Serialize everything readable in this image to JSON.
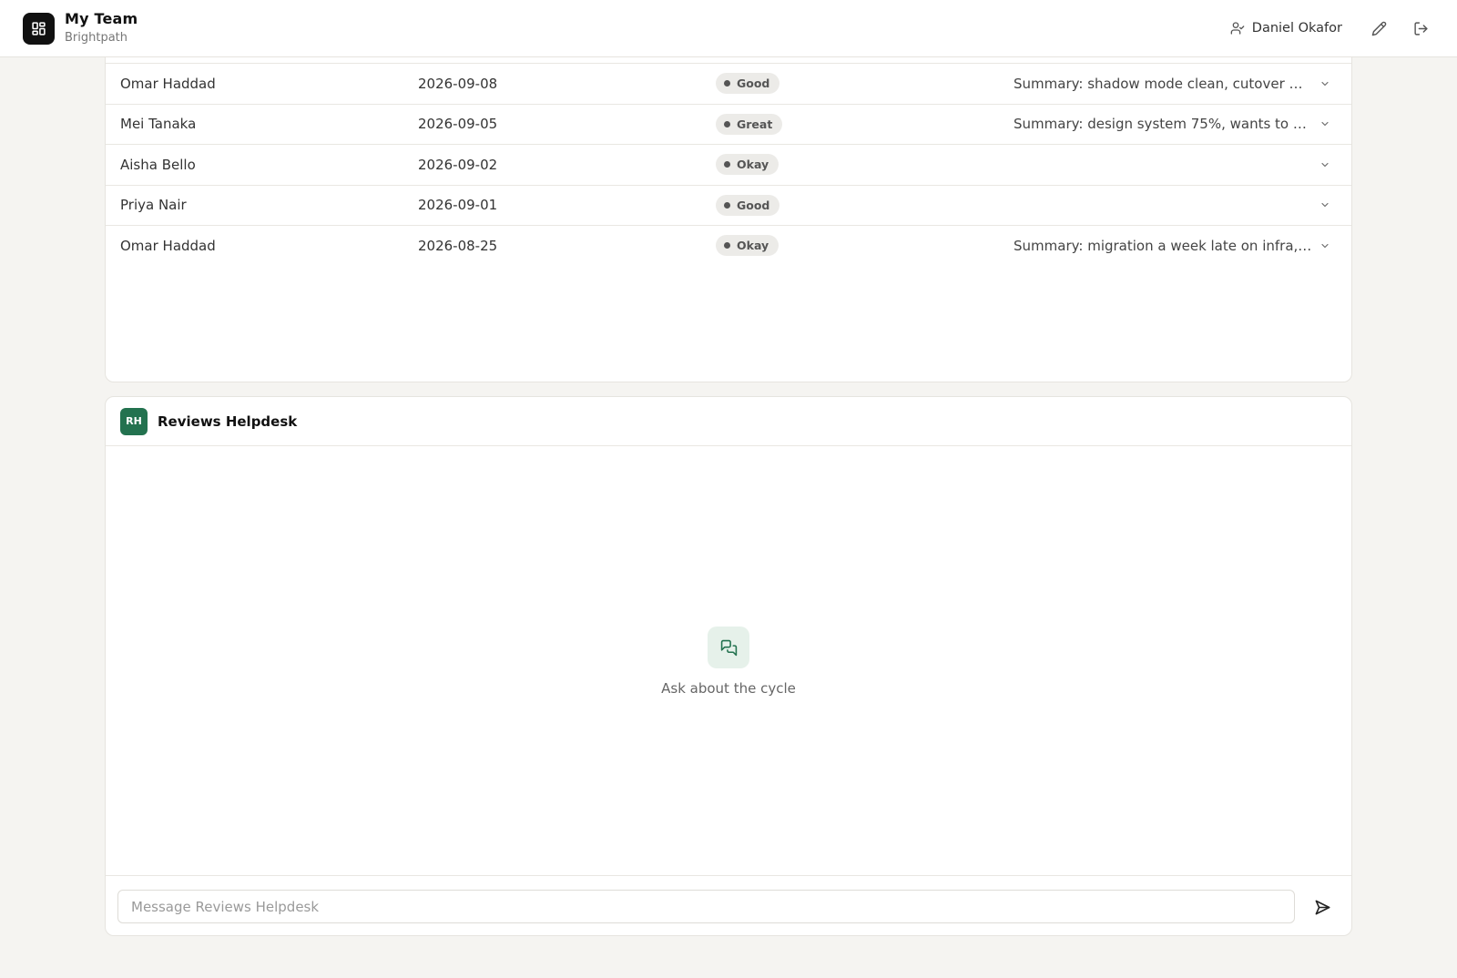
{
  "header": {
    "title": "My Team",
    "subtitle": "Brightpath",
    "user_name": "Daniel Okafor"
  },
  "reviews": {
    "rows": [
      {
        "name": "Omar Haddad",
        "date": "2026-09-08",
        "rating": "Good",
        "summary": "Summary: shadow mode clean, cutover mo..."
      },
      {
        "name": "Mei Tanaka",
        "date": "2026-09-05",
        "rating": "Great",
        "summary": "Summary: design system 75%, wants to me..."
      },
      {
        "name": "Aisha Bello",
        "date": "2026-09-02",
        "rating": "Okay",
        "summary": ""
      },
      {
        "name": "Priya Nair",
        "date": "2026-09-01",
        "rating": "Good",
        "summary": ""
      },
      {
        "name": "Omar Haddad",
        "date": "2026-08-25",
        "rating": "Okay",
        "summary": "Summary: migration a week late on infra, t..."
      }
    ]
  },
  "chat": {
    "avatar_initials": "RH",
    "title": "Reviews Helpdesk",
    "empty_text": "Ask about the cycle",
    "input_placeholder": "Message Reviews Helpdesk",
    "accent_color": "#23724f"
  }
}
